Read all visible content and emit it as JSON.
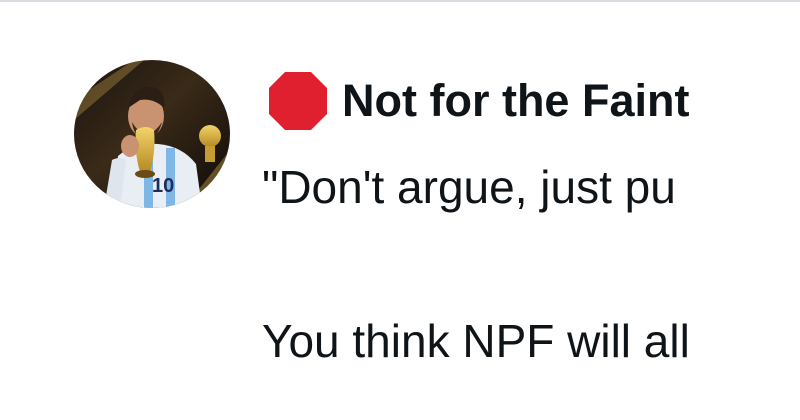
{
  "post": {
    "author": {
      "display_name": "Not for the Faint",
      "badge_icon": "stop-sign-icon",
      "badge_color": "#e0202f",
      "avatar": "profile-photo-avatar"
    },
    "text_lines": [
      "\"Don't argue, just pu",
      "You think NPF will all"
    ]
  },
  "colors": {
    "text": "#0f1419",
    "divider": "#d9dde1",
    "background": "#ffffff"
  }
}
